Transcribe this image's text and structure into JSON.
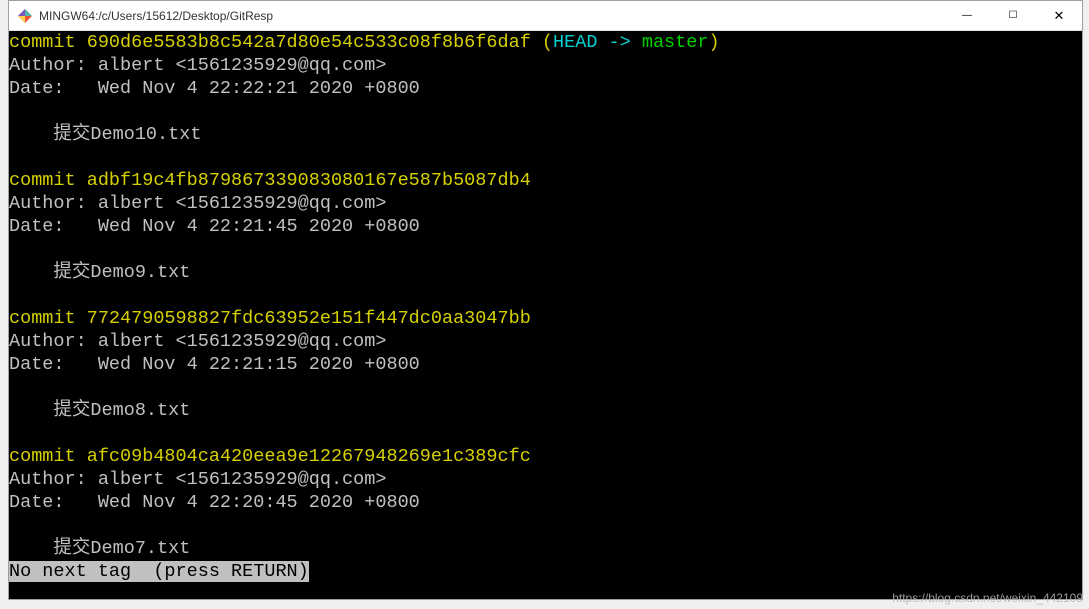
{
  "window": {
    "title": "MINGW64:/c/Users/15612/Desktop/GitResp"
  },
  "commits": [
    {
      "prefix": "commit ",
      "hash": "690d6e5583b8c542a7d80e54c533c08f8b6f6daf",
      "head_open": " (",
      "head_label": "HEAD -> ",
      "head_branch": "master",
      "head_close": ")",
      "author_line": "Author: albert <1561235929@qq.com>",
      "date_line": "Date:   Wed Nov 4 22:22:21 2020 +0800",
      "message": "    提交Demo10.txt"
    },
    {
      "prefix": "commit ",
      "hash": "adbf19c4fb879867339083080167e587b5087db4",
      "author_line": "Author: albert <1561235929@qq.com>",
      "date_line": "Date:   Wed Nov 4 22:21:45 2020 +0800",
      "message": "    提交Demo9.txt"
    },
    {
      "prefix": "commit ",
      "hash": "7724790598827fdc63952e151f447dc0aa3047bb",
      "author_line": "Author: albert <1561235929@qq.com>",
      "date_line": "Date:   Wed Nov 4 22:21:15 2020 +0800",
      "message": "    提交Demo8.txt"
    },
    {
      "prefix": "commit ",
      "hash": "afc09b4804ca420eea9e12267948269e1c389cfc",
      "author_line": "Author: albert <1561235929@qq.com>",
      "date_line": "Date:   Wed Nov 4 22:20:45 2020 +0800",
      "message": "    提交Demo7.txt"
    }
  ],
  "status_line": "No next tag  (press RETURN)",
  "watermark": "https://blog.csdn.net/weixin_442109"
}
